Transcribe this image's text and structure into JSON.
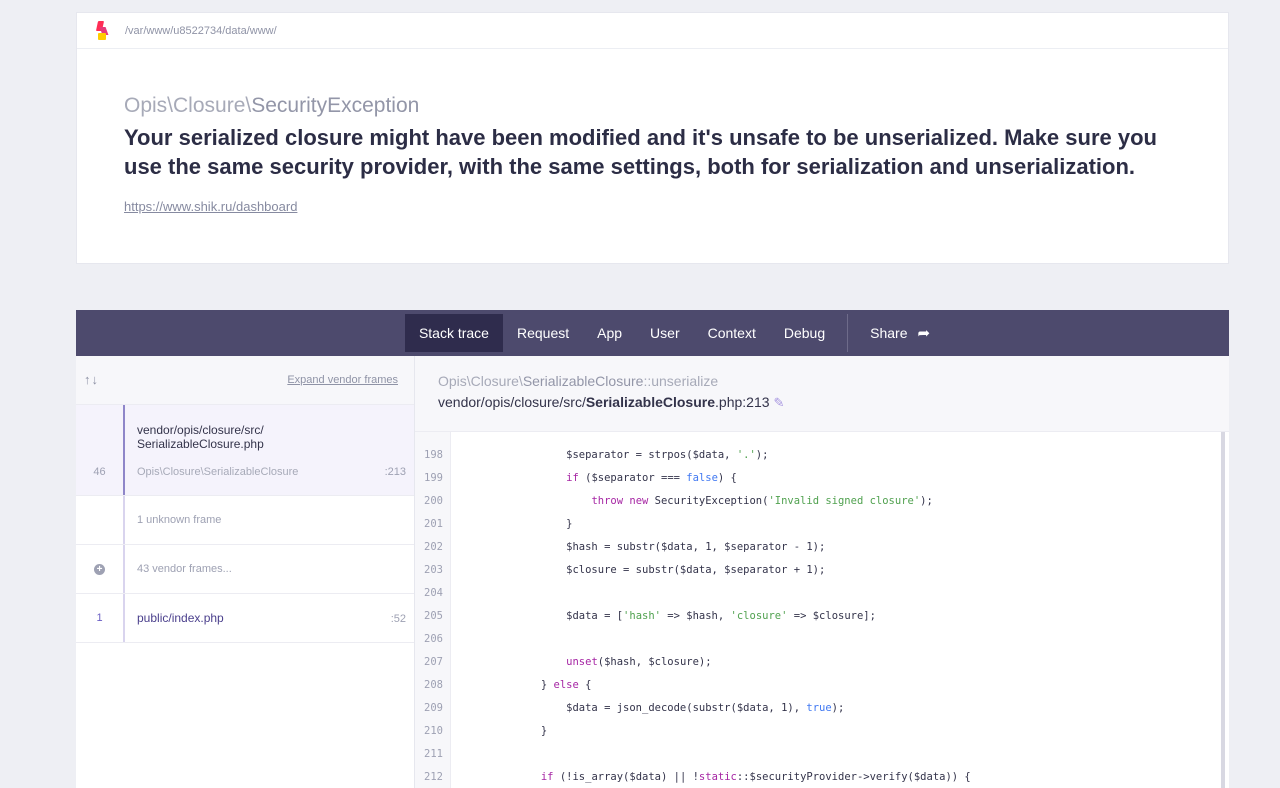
{
  "header": {
    "path": "/var/www/u8522734/data/www/"
  },
  "exception": {
    "class_prefix": "Opis\\Closure\\",
    "class_name": "SecurityException",
    "message": "Your serialized closure might have been modified and it's unsafe to be unserialized. Make sure you use the same security provider, with the same settings, both for serialization and unserialization.",
    "url": "https://www.shik.ru/dashboard"
  },
  "tabs": {
    "stack_trace": "Stack trace",
    "request": "Request",
    "app": "App",
    "user": "User",
    "context": "Context",
    "debug": "Debug",
    "share": "Share"
  },
  "sidebar": {
    "arrows": "↑↓",
    "expand_label": "Expand vendor frames",
    "frames": [
      {
        "num": "46",
        "file_dir": "vendor/opis/closure/src/",
        "file_name": "SerializableClosure.php",
        "class": "Opis\\Closure\\SerializableClosure",
        "line": ":213"
      },
      {
        "num": "",
        "label": "1 unknown frame"
      },
      {
        "num": "",
        "label": "43 vendor frames..."
      },
      {
        "num": "1",
        "file_dir": "public/",
        "file_name": "index.php",
        "line": ":52"
      }
    ]
  },
  "main": {
    "class_prefix": "Opis\\Closure\\",
    "class_name": "SerializableClosure",
    "method": "::unserialize",
    "file_dir": "vendor/opis/closure/src/",
    "file_name": "SerializableClosure",
    "file_ext": ".php:213",
    "code_lines": [
      {
        "n": "198",
        "t": "                $separator = strpos($data, '.');"
      },
      {
        "n": "199",
        "t": "                if ($separator === false) {"
      },
      {
        "n": "200",
        "t": "                    throw new SecurityException('Invalid signed closure');"
      },
      {
        "n": "201",
        "t": "                }"
      },
      {
        "n": "202",
        "t": "                $hash = substr($data, 1, $separator - 1);"
      },
      {
        "n": "203",
        "t": "                $closure = substr($data, $separator + 1);"
      },
      {
        "n": "204",
        "t": ""
      },
      {
        "n": "205",
        "t": "                $data = ['hash' => $hash, 'closure' => $closure];"
      },
      {
        "n": "206",
        "t": ""
      },
      {
        "n": "207",
        "t": "                unset($hash, $closure);"
      },
      {
        "n": "208",
        "t": "            } else {"
      },
      {
        "n": "209",
        "t": "                $data = json_decode(substr($data, 1), true);"
      },
      {
        "n": "210",
        "t": "            }"
      },
      {
        "n": "211",
        "t": ""
      },
      {
        "n": "212",
        "t": "            if (!is_array($data) || !static::$securityProvider->verify($data)) {"
      }
    ]
  },
  "colors": {
    "tabbar": "#4d4a6d",
    "tab_active": "#2f2c4d",
    "accent": "#8f86c9"
  }
}
